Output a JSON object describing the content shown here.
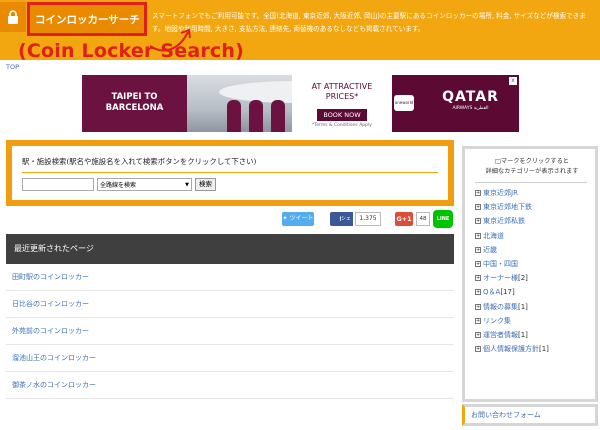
{
  "header": {
    "site_title": "コインロッカーサーチ",
    "description": "スマートフォンでもご利用可能です。全国(北海道, 東京近郊, 大阪近郊, 岡山)の主要駅にあるコインロッカーの場所, 料金, サイズなどが検索できます。地図や利用時間, 大きさ, 支払方法, 連絡先, 両替機のあるなしなども掲載されています。",
    "annotation": "(Coin Locker Search)",
    "accent_color": "#f2a60f",
    "annotation_color": "#e0201a"
  },
  "breadcrumb": {
    "top": "TOP"
  },
  "ad": {
    "left_line1": "TAIPEI TO",
    "left_line2": "BARCELONA",
    "offer_line1": "AT ATTRACTIVE",
    "offer_line2": "PRICES*",
    "book_now": "BOOK NOW",
    "terms": "*Terms & Conditions Apply",
    "badge": "oneworld",
    "brand": "QATAR",
    "brand_sub": "AIRWAYS القطرية",
    "close": "x"
  },
  "search": {
    "title": "駅・施設検索(駅名や施設名を入れて検索ボタンをクリックして下さい)",
    "input_value": "",
    "select_value": "全路線を検索",
    "button_label": "検索"
  },
  "social": {
    "tweet": "ツイート",
    "fb_label": "シェア",
    "fb_count": "1,375",
    "gplus_label": "G+1",
    "gplus_count": "48",
    "line_label": "LINE"
  },
  "recent": {
    "header": "最近更新されたページ",
    "items": [
      "田町駅のコインロッカー",
      "日比谷のコインロッカー",
      "外苑前のコインロッカー",
      "溜池山王のコインロッカー",
      "御茶ノ水のコインロッカー"
    ]
  },
  "sidebar": {
    "note_line1": "□マークをクリックすると",
    "note_line2": "詳細なカテゴリーが表示されます",
    "categories": [
      {
        "label": "東京近郊JR",
        "count": ""
      },
      {
        "label": "東京近郊地下鉄",
        "count": ""
      },
      {
        "label": "東京近郊私鉄",
        "count": ""
      },
      {
        "label": "北海道",
        "count": ""
      },
      {
        "label": "近畿",
        "count": ""
      },
      {
        "label": "中国・四国",
        "count": ""
      },
      {
        "label": "オーナー様",
        "count": "[2]"
      },
      {
        "label": "Q＆A",
        "count": "[17]"
      },
      {
        "label": "情報の募集",
        "count": "[1]"
      },
      {
        "label": "リンク集",
        "count": ""
      },
      {
        "label": "運営者情報",
        "count": "[1]"
      },
      {
        "label": "個人情報保護方針",
        "count": "[1]"
      }
    ]
  },
  "contact": {
    "label": "お問い合わせフォーム"
  }
}
